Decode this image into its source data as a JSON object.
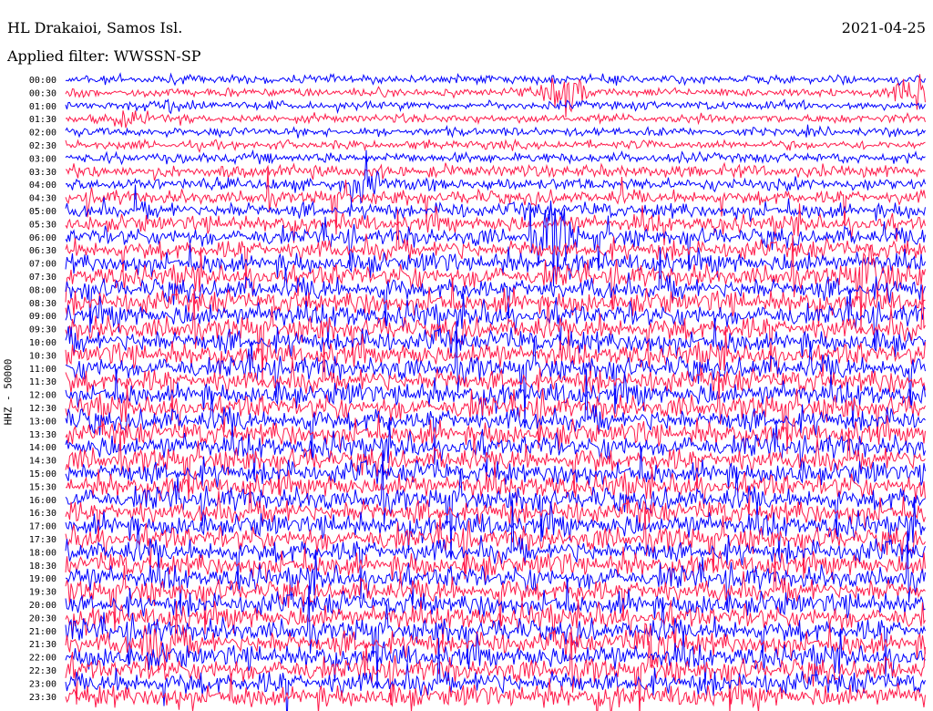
{
  "header": {
    "station": "HL Drakaioi, Samos Isl.",
    "filter": "Applied filter: WWSSN-SP",
    "date": "2021-04-25"
  },
  "chart_data": {
    "type": "line",
    "title": "HL Drakaioi, Samos Isl.",
    "subtitle": "Applied filter: WWSSN-SP",
    "ylabel": "HHZ - 50000",
    "xlabel": "",
    "tick_labels": [
      "00:00",
      "00:30",
      "01:00",
      "01:30",
      "02:00",
      "02:30",
      "03:00",
      "03:30",
      "04:00",
      "04:30",
      "05:00",
      "05:30",
      "06:00",
      "06:30",
      "07:00",
      "07:30",
      "08:00",
      "08:30",
      "09:00",
      "09:30",
      "10:00",
      "10:30",
      "11:00",
      "11:30",
      "12:00",
      "12:30",
      "13:00",
      "13:30",
      "14:00",
      "14:30",
      "15:00",
      "15:30",
      "16:00",
      "16:30",
      "17:00",
      "17:30",
      "18:00",
      "18:30",
      "19:00",
      "19:30",
      "20:00",
      "20:30",
      "21:00",
      "21:30",
      "22:00",
      "22:30",
      "23:00",
      "23:30"
    ],
    "trace_colors": [
      "#0000ff",
      "#ff1a4a"
    ],
    "noise_level_by_trace": [
      0.15,
      0.15,
      0.15,
      0.15,
      0.15,
      0.15,
      0.2,
      0.3,
      0.3,
      0.35,
      0.4,
      0.45,
      0.5,
      0.55,
      0.6,
      0.65,
      0.65,
      0.7,
      0.7,
      0.7,
      0.7,
      0.7,
      0.7,
      0.7,
      0.7,
      0.7,
      0.7,
      0.7,
      0.7,
      0.7,
      0.7,
      0.7,
      0.7,
      0.7,
      0.7,
      0.7,
      0.7,
      0.7,
      0.7,
      0.7,
      0.7,
      0.7,
      0.7,
      0.7,
      0.7,
      0.7,
      0.7,
      0.7
    ],
    "events": [
      {
        "trace": "00:30",
        "position": 0.58,
        "amplitude": 6.0
      },
      {
        "trace": "00:30",
        "position": 0.99,
        "amplitude": 9.0
      },
      {
        "trace": "01:00",
        "position": 0.13,
        "amplitude": 2.5
      },
      {
        "trace": "01:30",
        "position": 0.08,
        "amplitude": 2.0
      },
      {
        "trace": "04:00",
        "position": 0.35,
        "amplitude": 3.0
      },
      {
        "trace": "06:00",
        "position": 0.57,
        "amplitude": 4.0
      },
      {
        "trace": "07:30",
        "position": 0.94,
        "amplitude": 3.5
      },
      {
        "trace": "21:30",
        "position": 0.11,
        "amplitude": 3.0
      },
      {
        "trace": "21:30",
        "position": 0.69,
        "amplitude": 2.5
      }
    ]
  }
}
